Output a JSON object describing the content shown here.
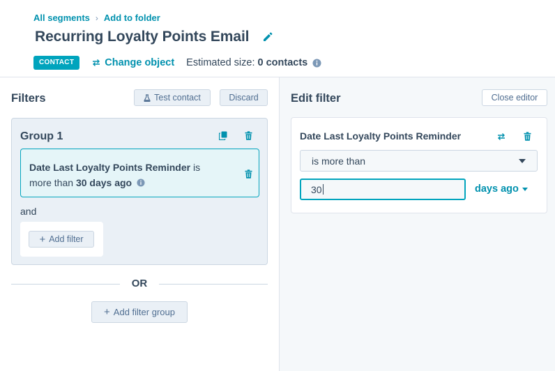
{
  "breadcrumb": {
    "items": [
      "All segments",
      "Add to folder"
    ],
    "separator": "›"
  },
  "page": {
    "title": "Recurring Loyalty Points Email"
  },
  "meta": {
    "object_badge": "CONTACT",
    "change_object_label": "Change object",
    "estimated_size_label": "Estimated size:",
    "estimated_size_value": "0 contacts"
  },
  "left_panel": {
    "title": "Filters",
    "test_contact_label": "Test contact",
    "discard_label": "Discard",
    "group": {
      "title": "Group 1",
      "filter": {
        "property": "Date Last Loyalty Points Reminder",
        "operator": "is",
        "operator_rest": "more than",
        "value": "30 days ago"
      },
      "joiner": "and",
      "add_filter_label": "Add filter"
    },
    "or_label": "OR",
    "add_filter_group_label": "Add filter group"
  },
  "right_panel": {
    "title": "Edit filter",
    "close_editor_label": "Close editor",
    "filter_property": "Date Last Loyalty Points Reminder",
    "operator_value": "is more than",
    "number_value": "30",
    "unit_value": "days ago"
  },
  "colors": {
    "accent": "#0091ae",
    "badge": "#00a4bd",
    "text": "#33475b",
    "panel_bg": "#eaf0f6",
    "border": "#cbd6e2"
  },
  "icons": {
    "edit": "pencil-icon",
    "swap": "swap-arrows-icon",
    "info": "info-icon",
    "clone": "clone-icon",
    "delete": "trash-icon",
    "flask": "flask-icon",
    "add": "plus-icon"
  }
}
